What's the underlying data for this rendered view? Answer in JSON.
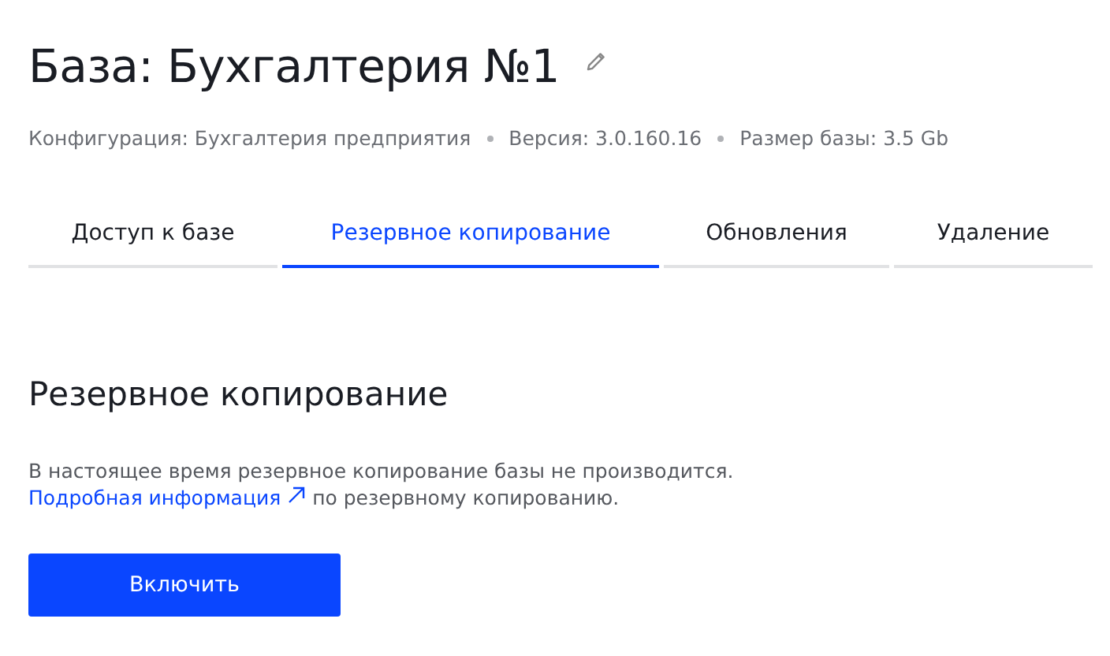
{
  "title": "База: Бухгалтерия №1",
  "meta": [
    "Конфигурация: Бухгалтерия предприятия",
    "Версия: 3.0.160.16",
    "Размер базы: 3.5 Gb"
  ],
  "tabs": [
    {
      "label": "Доступ к базе",
      "selected": false
    },
    {
      "label": "Резервное копирование",
      "selected": true
    },
    {
      "label": "Обновления",
      "selected": false
    },
    {
      "label": "Удаление",
      "selected": false
    }
  ],
  "section": {
    "heading": "Резервное копирование",
    "text": "В настоящее время резервное копирование базы не производится.",
    "link": "Подробная информация",
    "link_tail": "по резервному копированию.",
    "button": "Включить"
  }
}
